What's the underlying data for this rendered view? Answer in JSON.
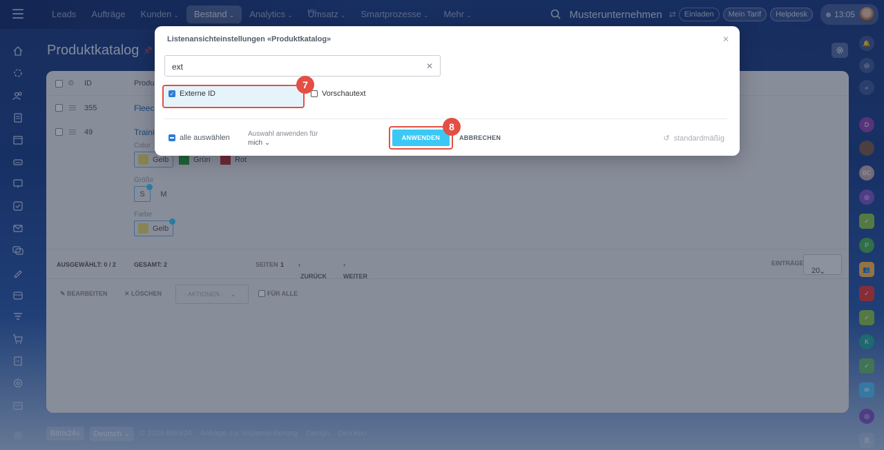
{
  "topbar": {
    "nav": [
      {
        "label": "Leads",
        "chevron": false
      },
      {
        "label": "Aufträge",
        "chevron": false
      },
      {
        "label": "Kunden",
        "chevron": true
      },
      {
        "label": "Bestand",
        "chevron": true,
        "active": true
      },
      {
        "label": "Analytics",
        "chevron": true
      },
      {
        "label": "Umsatz",
        "chevron": true,
        "superscript": "NEU"
      },
      {
        "label": "Smartprozesse",
        "chevron": true
      },
      {
        "label": "Mehr",
        "chevron": true
      }
    ],
    "company": "Musterunternehmen",
    "invite": "Einladen",
    "tariff": "Mein Tarif",
    "helpdesk": "Helpdesk",
    "time": "13:05"
  },
  "page": {
    "title": "Produktkatalog"
  },
  "grid": {
    "header": {
      "id": "ID",
      "name": "Produ"
    },
    "rows": [
      {
        "id": "355",
        "name": "Fleece"
      },
      {
        "id": "49",
        "name": "Trainin"
      }
    ],
    "props": {
      "color_label": "Color",
      "colors": [
        "Gelb",
        "Grün",
        "Rot"
      ],
      "size_label": "Größe",
      "sizes": [
        "S",
        "M"
      ],
      "farbe_label": "Farbe",
      "farbe": [
        "Gelb"
      ]
    },
    "pager": {
      "selected": "AUSGEWÄHLT: 0 / 2",
      "total": "GESAMT: 2",
      "pages_label": "SEITEN",
      "page": "1",
      "back": "ZURÜCK",
      "next": "WEITER",
      "entries_label": "EINTRÄGE",
      "entries_value": "20"
    },
    "actions": {
      "edit": "BEARBEITEN",
      "delete": "LÖSCHEN",
      "actions_select": "- AKTIONEN -",
      "for_all": "FÜR ALLE"
    }
  },
  "footer": {
    "brand": "Bitrix24",
    "language": "Deutsch",
    "copyright": "© 2026 Bitrix24",
    "impl": "Anfrage zur Implementierung",
    "design": "Design",
    "print": "Drucken"
  },
  "dialog": {
    "title": "Listenansichteinstellungen «Produktkatalog»",
    "search_value": "ext",
    "fields": [
      {
        "label": "Externe ID",
        "checked": true
      },
      {
        "label": "Vorschautext",
        "checked": false
      }
    ],
    "select_all": "alle auswählen",
    "apply_for_label": "Auswahl anwenden für",
    "apply_for_value": "mich",
    "apply": "ANWENDEN",
    "cancel": "ABBRECHEN",
    "reset": "standardmäßig",
    "badges": [
      "7",
      "8"
    ]
  },
  "right_sidebar": {
    "initials": [
      "D",
      "BC",
      "P",
      "K"
    ]
  }
}
